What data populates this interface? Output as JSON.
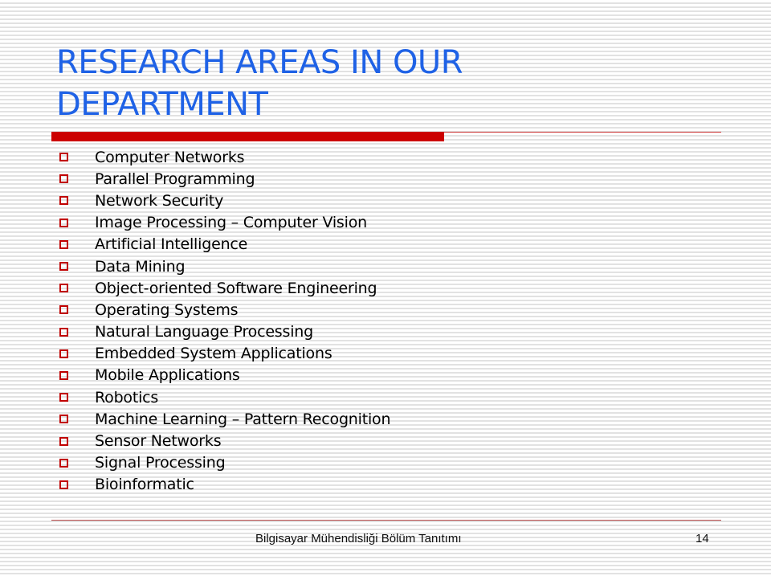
{
  "slide": {
    "title": "RESEARCH AREAS IN OUR DEPARTMENT",
    "items": [
      "Computer Networks",
      "Parallel Programming",
      "Network Security",
      "Image Processing – Computer Vision",
      "Artificial Intelligence",
      "Data Mining",
      "Object-oriented Software Engineering",
      "Operating Systems",
      "Natural Language Processing",
      "Embedded System Applications",
      "Mobile Applications",
      "Robotics",
      "Machine Learning – Pattern Recognition",
      "Sensor Networks",
      "Signal Processing",
      "Bioinformatic"
    ],
    "bullet_icon": "hollow-square-bullet",
    "footer": "Bilgisayar Mühendisliği Bölüm Tanıtımı",
    "page_number": "14"
  },
  "colors": {
    "title": "#1f62e6",
    "accent": "#cc0000",
    "text": "#000000"
  }
}
